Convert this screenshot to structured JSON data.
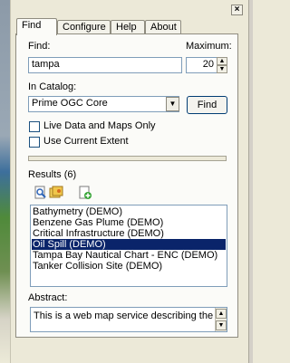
{
  "tabs": [
    {
      "label": "Find"
    },
    {
      "label": "Configure"
    },
    {
      "label": "Help"
    },
    {
      "label": "About"
    }
  ],
  "close_glyph": "×",
  "find": {
    "label": "Find:",
    "value": "tampa",
    "maximum_label": "Maximum:",
    "maximum_value": "20",
    "catalog_label": "In Catalog:",
    "catalog_value": "Prime OGC Core",
    "find_button": "Find",
    "live_data_label": "Live Data and Maps Only",
    "current_extent_label": "Use Current Extent"
  },
  "results": {
    "label": "Results (6)",
    "items": [
      "Bathymetry (DEMO)",
      "Benzene Gas Plume (DEMO)",
      "Critical Infrastructure (DEMO)",
      "Oil Spill (DEMO)",
      "Tampa Bay Nautical Chart - ENC (DEMO)",
      "Tanker Collision Site (DEMO)"
    ],
    "selected_index": 3
  },
  "abstract": {
    "label": "Abstract:",
    "text": "This is a web map service describing the"
  },
  "colors": {
    "selection": "#0a246a",
    "panel": "#ece9d8"
  }
}
